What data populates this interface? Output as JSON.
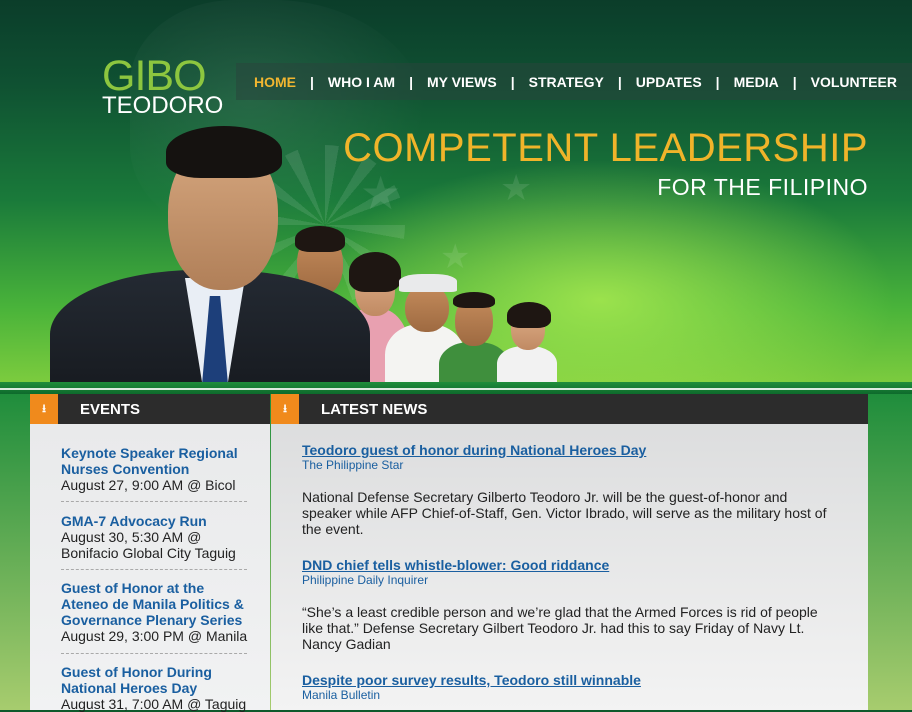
{
  "logo": {
    "line1": "GIBO",
    "line2": "TEODORO"
  },
  "nav": {
    "items": [
      {
        "label": "HOME",
        "active": true
      },
      {
        "label": "WHO I AM"
      },
      {
        "label": "MY VIEWS"
      },
      {
        "label": "STRATEGY"
      },
      {
        "label": "UPDATES"
      },
      {
        "label": "MEDIA"
      },
      {
        "label": "VOLUNTEER"
      }
    ],
    "separator": "|"
  },
  "hero": {
    "headline": "COMPETENT LEADERSHIP",
    "subheadline": "FOR THE FILIPINO"
  },
  "events": {
    "header": "EVENTS",
    "items": [
      {
        "title": "Keynote Speaker Regional Nurses Convention",
        "meta": "August 27, 9:00 AM @ Bicol"
      },
      {
        "title": "GMA-7 Advocacy Run",
        "meta": "August 30, 5:30 AM @ Bonifacio Global City Taguig"
      },
      {
        "title": "Guest of Honor at the Ateneo de Manila Politics & Governance Plenary Series",
        "meta": "August 29, 3:00 PM @ Manila"
      },
      {
        "title": "Guest of Honor During National Heroes Day",
        "meta": "August 31, 7:00 AM @ Taguig"
      }
    ]
  },
  "news": {
    "header": "LATEST NEWS",
    "items": [
      {
        "title": "Teodoro guest of honor during National Heroes Day",
        "source": "The Philippine Star",
        "body": "National Defense Secretary Gilberto Teodoro Jr. will be the guest-of-honor and speaker while AFP Chief-of-Staff, Gen. Victor Ibrado, will serve as the military host of the event."
      },
      {
        "title": "DND chief tells whistle-blower: Good riddance",
        "source": "Philippine Daily Inquirer",
        "body": "“She’s a least credible person and we’re glad that the Armed Forces is rid of people like that.” Defense Secretary Gilbert Teodoro Jr. had this to say Friday of Navy Lt. Nancy Gadian"
      },
      {
        "title": "Despite poor survey results, Teodoro still winnable",
        "source": "Manila Bulletin"
      }
    ]
  },
  "colors": {
    "accent": "#f0b42a",
    "logo_green": "#8dc63f",
    "link": "#1a5fa0",
    "rss_orange": "#f08a1c"
  }
}
